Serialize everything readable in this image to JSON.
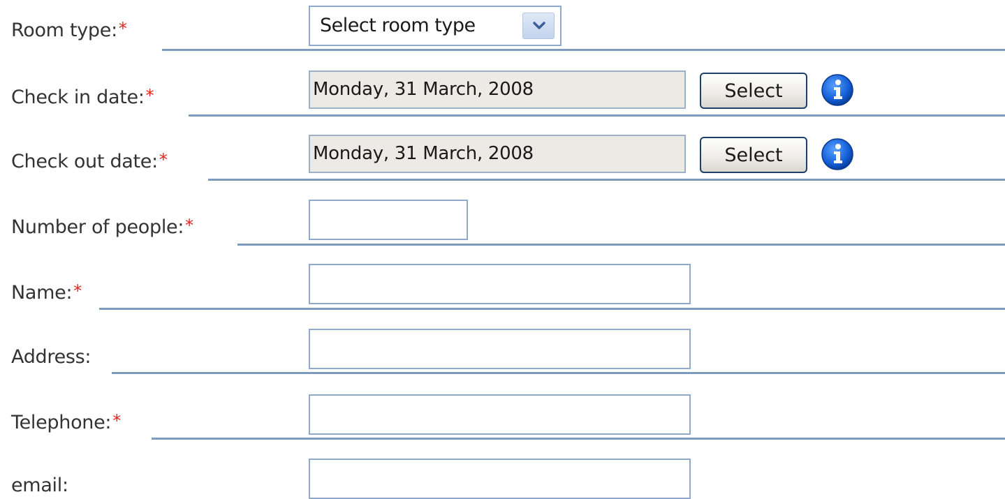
{
  "form": {
    "room_type": {
      "label": "Room type:",
      "required_mark": "*",
      "selected": "Select room type"
    },
    "check_in": {
      "label": "Check in date:",
      "required_mark": "*",
      "value": "Monday, 31 March, 2008",
      "button_label": "Select"
    },
    "check_out": {
      "label": "Check out date:",
      "required_mark": "*",
      "value": "Monday, 31 March, 2008",
      "button_label": "Select"
    },
    "people": {
      "label": "Number of people:",
      "required_mark": "*",
      "value": ""
    },
    "name": {
      "label": "Name:",
      "required_mark": "*",
      "value": ""
    },
    "address": {
      "label": "Address:",
      "value": ""
    },
    "telephone": {
      "label": "Telephone:",
      "required_mark": "*",
      "value": ""
    },
    "email": {
      "label": "email:",
      "value": ""
    }
  },
  "icons": {
    "info": "info-icon",
    "dropdown": "chevron-down-icon"
  },
  "colors": {
    "required": "#e8221c",
    "rule": "#7d9bbd",
    "input_border": "#8fa9cc",
    "info_blue": "#1560d8"
  }
}
